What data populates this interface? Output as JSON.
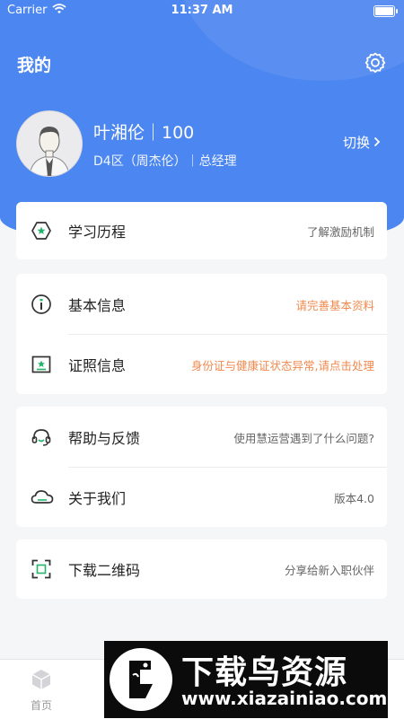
{
  "status_bar": {
    "carrier": "Carrier",
    "time": "11:37 AM"
  },
  "header": {
    "title": "我的",
    "settings_icon": "gear-icon"
  },
  "profile": {
    "name_line": "叶湘伦｜100",
    "sub_line": "D4区（周杰伦）｜总经理",
    "switch_label": "切换"
  },
  "menu": {
    "learning": {
      "label": "学习历程",
      "hint": "了解激励机制",
      "icon": "hexagon-star-icon"
    },
    "basic_info": {
      "label": "基本信息",
      "hint": "请完善基本资料",
      "icon": "info-icon"
    },
    "license": {
      "label": "证照信息",
      "hint": "身份证与健康证状态异常,请点击处理",
      "icon": "certificate-icon"
    },
    "help": {
      "label": "帮助与反馈",
      "hint": "使用慧运营遇到了什么问题?",
      "icon": "headset-icon"
    },
    "about": {
      "label": "关于我们",
      "hint": "版本4.0",
      "icon": "cloud-icon"
    },
    "qrcode": {
      "label": "下载二维码",
      "hint": "分享给新入职伙伴",
      "icon": "qr-scan-icon"
    }
  },
  "tabbar": {
    "home_label": "首页",
    "home_icon": "cube-icon"
  },
  "watermark": {
    "title": "下载鸟资源",
    "url": "www.xiazainiao.com"
  },
  "colors": {
    "brand_blue": "#4c86f0",
    "warn_orange": "#f0894e",
    "icon_green": "#23b36b"
  }
}
